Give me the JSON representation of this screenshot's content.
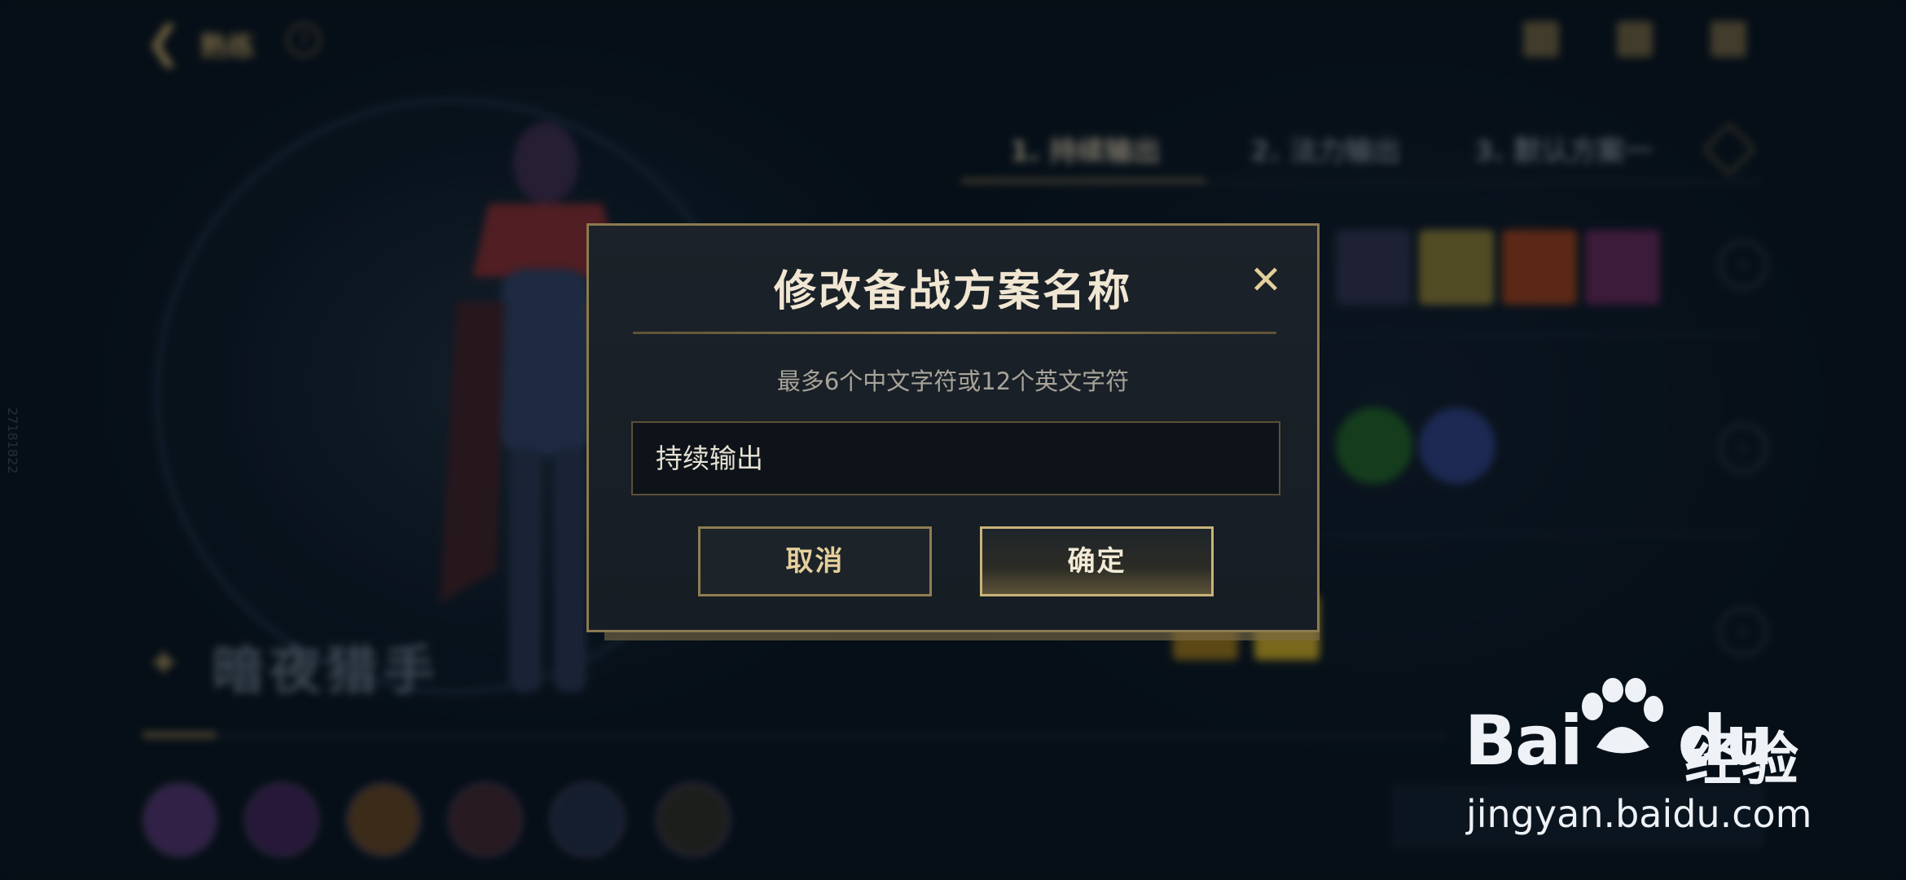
{
  "header": {
    "back_label": "熟练",
    "help_symbol": "?"
  },
  "plan_tabs": [
    {
      "label": "1. 持续输出",
      "active": true
    },
    {
      "label": "2. 法力输出",
      "active": false
    },
    {
      "label": "3. 默认方案一",
      "active": false
    }
  ],
  "champion": {
    "name": "暗夜猎手"
  },
  "side_text": "27181822",
  "modal": {
    "title": "修改备战方案名称",
    "close_symbol": "✕",
    "hint": "最多6个中文字符或12个英文字符",
    "input_value": "持续输出",
    "cancel_label": "取消",
    "confirm_label": "确定"
  },
  "watermark": {
    "brand_left": "Bai",
    "brand_right": "du",
    "brand_cn": "经验",
    "url": "jingyan.baidu.com"
  },
  "colors": {
    "gold_border": "#8c7a50",
    "title_text": "#f0e6d2",
    "modal_bg": "#1b2229"
  }
}
